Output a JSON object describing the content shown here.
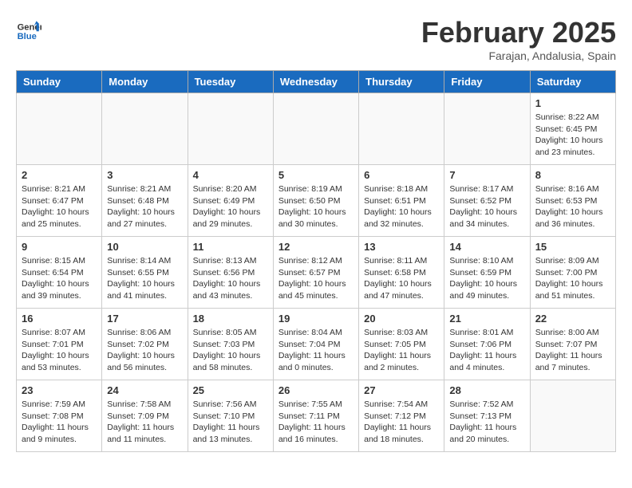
{
  "header": {
    "logo_line1": "General",
    "logo_line2": "Blue",
    "title": "February 2025",
    "subtitle": "Farajan, Andalusia, Spain"
  },
  "weekdays": [
    "Sunday",
    "Monday",
    "Tuesday",
    "Wednesday",
    "Thursday",
    "Friday",
    "Saturday"
  ],
  "weeks": [
    [
      {
        "day": "",
        "info": ""
      },
      {
        "day": "",
        "info": ""
      },
      {
        "day": "",
        "info": ""
      },
      {
        "day": "",
        "info": ""
      },
      {
        "day": "",
        "info": ""
      },
      {
        "day": "",
        "info": ""
      },
      {
        "day": "1",
        "info": "Sunrise: 8:22 AM\nSunset: 6:45 PM\nDaylight: 10 hours\nand 23 minutes."
      }
    ],
    [
      {
        "day": "2",
        "info": "Sunrise: 8:21 AM\nSunset: 6:47 PM\nDaylight: 10 hours\nand 25 minutes."
      },
      {
        "day": "3",
        "info": "Sunrise: 8:21 AM\nSunset: 6:48 PM\nDaylight: 10 hours\nand 27 minutes."
      },
      {
        "day": "4",
        "info": "Sunrise: 8:20 AM\nSunset: 6:49 PM\nDaylight: 10 hours\nand 29 minutes."
      },
      {
        "day": "5",
        "info": "Sunrise: 8:19 AM\nSunset: 6:50 PM\nDaylight: 10 hours\nand 30 minutes."
      },
      {
        "day": "6",
        "info": "Sunrise: 8:18 AM\nSunset: 6:51 PM\nDaylight: 10 hours\nand 32 minutes."
      },
      {
        "day": "7",
        "info": "Sunrise: 8:17 AM\nSunset: 6:52 PM\nDaylight: 10 hours\nand 34 minutes."
      },
      {
        "day": "8",
        "info": "Sunrise: 8:16 AM\nSunset: 6:53 PM\nDaylight: 10 hours\nand 36 minutes."
      }
    ],
    [
      {
        "day": "9",
        "info": "Sunrise: 8:15 AM\nSunset: 6:54 PM\nDaylight: 10 hours\nand 39 minutes."
      },
      {
        "day": "10",
        "info": "Sunrise: 8:14 AM\nSunset: 6:55 PM\nDaylight: 10 hours\nand 41 minutes."
      },
      {
        "day": "11",
        "info": "Sunrise: 8:13 AM\nSunset: 6:56 PM\nDaylight: 10 hours\nand 43 minutes."
      },
      {
        "day": "12",
        "info": "Sunrise: 8:12 AM\nSunset: 6:57 PM\nDaylight: 10 hours\nand 45 minutes."
      },
      {
        "day": "13",
        "info": "Sunrise: 8:11 AM\nSunset: 6:58 PM\nDaylight: 10 hours\nand 47 minutes."
      },
      {
        "day": "14",
        "info": "Sunrise: 8:10 AM\nSunset: 6:59 PM\nDaylight: 10 hours\nand 49 minutes."
      },
      {
        "day": "15",
        "info": "Sunrise: 8:09 AM\nSunset: 7:00 PM\nDaylight: 10 hours\nand 51 minutes."
      }
    ],
    [
      {
        "day": "16",
        "info": "Sunrise: 8:07 AM\nSunset: 7:01 PM\nDaylight: 10 hours\nand 53 minutes."
      },
      {
        "day": "17",
        "info": "Sunrise: 8:06 AM\nSunset: 7:02 PM\nDaylight: 10 hours\nand 56 minutes."
      },
      {
        "day": "18",
        "info": "Sunrise: 8:05 AM\nSunset: 7:03 PM\nDaylight: 10 hours\nand 58 minutes."
      },
      {
        "day": "19",
        "info": "Sunrise: 8:04 AM\nSunset: 7:04 PM\nDaylight: 11 hours\nand 0 minutes."
      },
      {
        "day": "20",
        "info": "Sunrise: 8:03 AM\nSunset: 7:05 PM\nDaylight: 11 hours\nand 2 minutes."
      },
      {
        "day": "21",
        "info": "Sunrise: 8:01 AM\nSunset: 7:06 PM\nDaylight: 11 hours\nand 4 minutes."
      },
      {
        "day": "22",
        "info": "Sunrise: 8:00 AM\nSunset: 7:07 PM\nDaylight: 11 hours\nand 7 minutes."
      }
    ],
    [
      {
        "day": "23",
        "info": "Sunrise: 7:59 AM\nSunset: 7:08 PM\nDaylight: 11 hours\nand 9 minutes."
      },
      {
        "day": "24",
        "info": "Sunrise: 7:58 AM\nSunset: 7:09 PM\nDaylight: 11 hours\nand 11 minutes."
      },
      {
        "day": "25",
        "info": "Sunrise: 7:56 AM\nSunset: 7:10 PM\nDaylight: 11 hours\nand 13 minutes."
      },
      {
        "day": "26",
        "info": "Sunrise: 7:55 AM\nSunset: 7:11 PM\nDaylight: 11 hours\nand 16 minutes."
      },
      {
        "day": "27",
        "info": "Sunrise: 7:54 AM\nSunset: 7:12 PM\nDaylight: 11 hours\nand 18 minutes."
      },
      {
        "day": "28",
        "info": "Sunrise: 7:52 AM\nSunset: 7:13 PM\nDaylight: 11 hours\nand 20 minutes."
      },
      {
        "day": "",
        "info": ""
      }
    ]
  ]
}
